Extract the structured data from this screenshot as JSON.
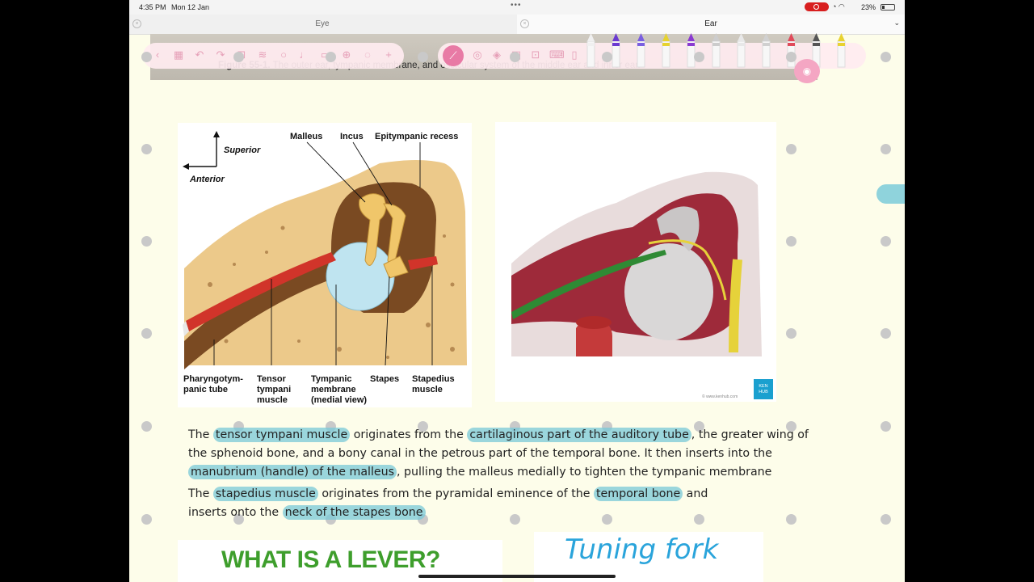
{
  "status_bar": {
    "time": "4:35 PM",
    "date": "Mon 12 Jan",
    "battery": "23%"
  },
  "tabs": [
    {
      "label": "Eye",
      "active": false
    },
    {
      "label": "Ear",
      "active": true
    }
  ],
  "header_figure": {
    "caption_label": "Figure 55-1.",
    "caption_text": "The outer ear, tympanic membrane, and ossicular system of the middle ear and inner ear."
  },
  "toolbar": {
    "left_icons": [
      "back-icon",
      "grid-icon",
      "undo-icon",
      "redo-icon",
      "add-page-icon",
      "layers-icon",
      "search-icon",
      "microphone-icon",
      "bookmark-icon",
      "globe-icon",
      "share-icon",
      "plus-icon"
    ],
    "right_tools": [
      "lasso-icon",
      "eraser-icon",
      "highlighter-icon",
      "image-icon",
      "crop-icon",
      "keyboard-icon",
      "book-icon"
    ],
    "pen_colors": [
      "#f0f0f0",
      "#6a3ad0",
      "#7a5ee0",
      "#e6d230",
      "#8a3ad0",
      "#cccccc",
      "#e8e8e8",
      "#d0d0d0",
      "#e04a5a",
      "#555555",
      "#e8d230"
    ]
  },
  "figure1": {
    "labels": {
      "superior": "Superior",
      "anterior": "Anterior",
      "malleus": "Malleus",
      "incus": "Incus",
      "epitympanic_recess": "Epitympanic recess",
      "pharyngotympanic_tube_1": "Pharyngotym-",
      "pharyngotympanic_tube_2": "panic tube",
      "tensor_1": "Tensor",
      "tensor_2": "tympani",
      "tensor_3": "muscle",
      "tympanic_1": "Tympanic",
      "tympanic_2": "membrane",
      "tympanic_3": "(medial view)",
      "stapes": "Stapes",
      "stapedius_1": "Stapedius",
      "stapedius_2": "muscle"
    }
  },
  "figure2": {
    "watermark": "© www.kenhub.com",
    "logo_line1": "KEN",
    "logo_line2": "HUB"
  },
  "notes": {
    "p1_l1_a": "The ",
    "p1_l1_hl1": "tensor tympani muscle",
    "p1_l1_b": " originates from the ",
    "p1_l1_hl2": "cartilaginous part of the auditory tube",
    "p1_l1_c": ", the greater wing of",
    "p1_l2": "the sphenoid bone, and a bony canal in the petrous part of the temporal bone. It then inserts into the",
    "p1_l3_hl": "manubrium (handle) of the malleus",
    "p1_l3_b": ", pulling the malleus medially to tighten the tympanic membrane",
    "p2_l1_a": "The ",
    "p2_l1_hl1": "stapedius muscle",
    "p2_l1_b": " originates from the pyramidal eminence of the ",
    "p2_l1_hl2": "temporal bone",
    "p2_l1_c": " and",
    "p2_l2_a": "inserts onto the ",
    "p2_l2_hl": "neck of the stapes bone"
  },
  "cards": {
    "lever_title": "WHAT IS A LEVER?",
    "tuning_title": "Tuning fork"
  }
}
